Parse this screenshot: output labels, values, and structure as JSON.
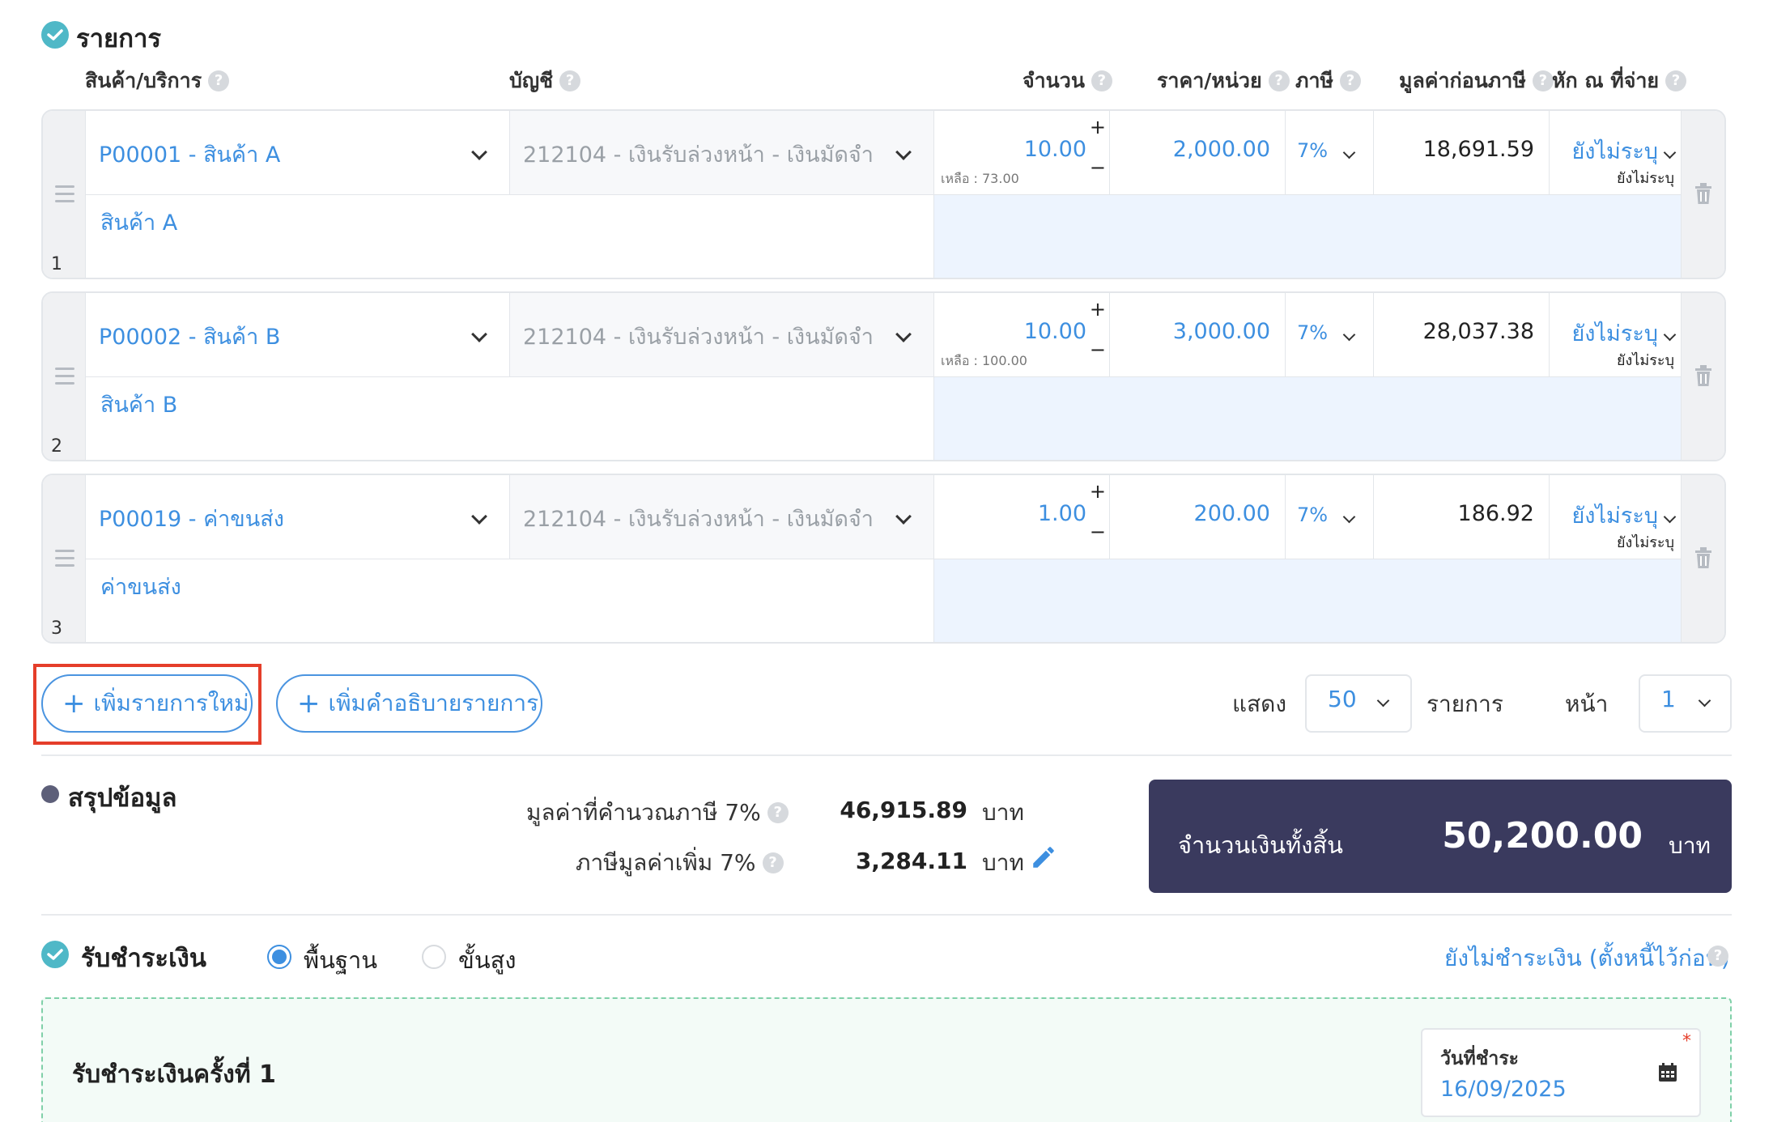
{
  "section_items": {
    "title": "รายการ"
  },
  "columns": {
    "product": "สินค้า/บริการ",
    "account": "บัญชี",
    "qty": "จำนวน",
    "price": "ราคา/หน่วย",
    "tax": "ภาษี",
    "pretax": "มูลค่าก่อนภาษี",
    "wht": "หัก ณ ที่จ่าย"
  },
  "items": [
    {
      "num": "1",
      "product": "P00001 - สินค้า A",
      "account": "212104 - เงินรับล่วงหน้า - เงินมัดจำ",
      "qty": "10.00",
      "remain": "เหลือ : 73.00",
      "price": "2,000.00",
      "tax": "7%",
      "pretax": "18,691.59",
      "wht": "ยังไม่ระบุ",
      "wht_sub": "ยังไม่ระบุ",
      "desc": "สินค้า A"
    },
    {
      "num": "2",
      "product": "P00002 - สินค้า B",
      "account": "212104 - เงินรับล่วงหน้า - เงินมัดจำ",
      "qty": "10.00",
      "remain": "เหลือ : 100.00",
      "price": "3,000.00",
      "tax": "7%",
      "pretax": "28,037.38",
      "wht": "ยังไม่ระบุ",
      "wht_sub": "ยังไม่ระบุ",
      "desc": "สินค้า B"
    },
    {
      "num": "3",
      "product": "P00019 - ค่าขนส่ง",
      "account": "212104 - เงินรับล่วงหน้า - เงินมัดจำ",
      "qty": "1.00",
      "remain": "",
      "price": "200.00",
      "tax": "7%",
      "pretax": "186.92",
      "wht": "ยังไม่ระบุ",
      "wht_sub": "ยังไม่ระบุ",
      "desc": "ค่าขนส่ง"
    }
  ],
  "actions": {
    "add_item": "เพิ่มรายการใหม่",
    "add_desc": "เพิ่มคำอธิบายรายการ",
    "plus": "+"
  },
  "pagination": {
    "show_label": "แสดง",
    "per_page": "50",
    "items_label": "รายการ",
    "page_label": "หน้า",
    "page": "1"
  },
  "summary": {
    "title": "สรุปข้อมูล",
    "taxable_label": "มูลค่าที่คำนวณภาษี 7%",
    "taxable_value": "46,915.89",
    "vat_label": "ภาษีมูลค่าเพิ่ม 7%",
    "vat_value": "3,284.11",
    "unit": "บาท",
    "total_label": "จำนวนเงินทั้งสิ้น",
    "total_value": "50,200.00"
  },
  "payment": {
    "title": "รับชำระเงิน",
    "mode_basic": "พื้นฐาน",
    "mode_advanced": "ขั้นสูง",
    "unpaid_link": "ยังไม่ชำระเงิน (ตั้งหนี้ไว้ก่อน)",
    "installment_title": "รับชำระเงินครั้งที่ 1",
    "date_label": "วันที่ชำระ",
    "date_value": "16/09/2025",
    "required_mark": "*"
  },
  "colors": {
    "accent": "#3d8fe0",
    "teal": "#4fb8c7",
    "total_bg": "#3a3a5e",
    "highlight": "#e53e2a"
  }
}
